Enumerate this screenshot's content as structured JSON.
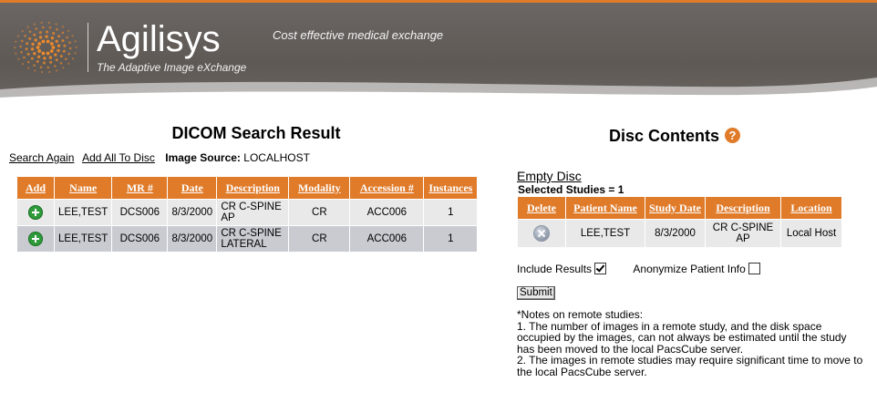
{
  "header": {
    "brand": "Agilisys",
    "tagline": "The Adaptive Image eXchange",
    "slogan": "Cost effective medical exchange"
  },
  "colors": {
    "accent": "#e07b2a",
    "header_gray": "#615c58",
    "row_light": "#e9e9e9",
    "row_dark": "#c9cbd1",
    "add_green": "#2f9a3a"
  },
  "search": {
    "title": "DICOM Search Result",
    "search_again": "Search Again",
    "add_all": "Add All To Disc",
    "source_label": "Image Source:",
    "source_value": "LOCALHOST",
    "columns": [
      "Add",
      "Name",
      "MR #",
      "Date",
      "Description",
      "Modality",
      "Accession #",
      "Instances"
    ],
    "rows": [
      {
        "icon": "add-icon",
        "name": "LEE,TEST",
        "mr": "DCS006",
        "date": "8/3/2000",
        "description": "CR C-SPINE AP",
        "modality": "CR",
        "accession": "ACC006",
        "instances": "1"
      },
      {
        "icon": "add-icon",
        "name": "LEE,TEST",
        "mr": "DCS006",
        "date": "8/3/2000",
        "description": "CR C-SPINE LATERAL",
        "modality": "CR",
        "accession": "ACC006",
        "instances": "1"
      }
    ]
  },
  "disc": {
    "title": "Disc Contents",
    "help_glyph": "?",
    "empty_disc": "Empty Disc",
    "selected": "Selected Studies = 1",
    "columns": [
      "Delete",
      "Patient Name",
      "Study Date",
      "Description",
      "Location"
    ],
    "rows": [
      {
        "icon": "delete-icon",
        "patient": "LEE,TEST",
        "study_date": "8/3/2000",
        "description": "CR C-SPINE AP",
        "location": "Local Host"
      }
    ],
    "include_results": {
      "label": "Include Results",
      "checked": true
    },
    "anonymize": {
      "label": "Anonymize Patient Info",
      "checked": false
    },
    "submit": "Submit",
    "notes": [
      "*Notes on remote studies:",
      "1. The number of images in a remote study, and the disk space occupied by the images, can not always be estimated until the study has been moved to the local PacsCube server.",
      "2. The images in remote studies may require significant time to move to the local PacsCube server."
    ]
  }
}
